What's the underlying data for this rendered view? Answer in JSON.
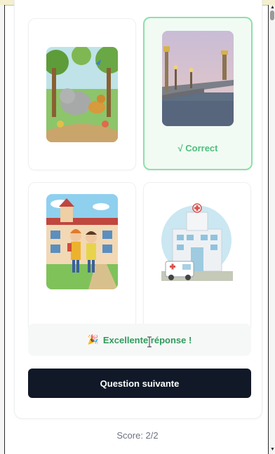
{
  "options": [
    {
      "image_icon": "jungle-animals-image",
      "selected": false
    },
    {
      "image_icon": "paris-bridge-image",
      "selected": true,
      "status_label": "√ Correct"
    },
    {
      "image_icon": "school-children-image",
      "selected": false
    },
    {
      "image_icon": "hospital-ambulance-image",
      "selected": false
    }
  ],
  "feedback": {
    "emoji": "🎉",
    "text": "Excellente réponse !"
  },
  "next_button": {
    "label": "Question suivante"
  },
  "score": {
    "text": "Score: 2/2"
  },
  "colors": {
    "correct": "#4cc07a",
    "selected_border": "#8ee0a8",
    "button_bg": "#111827",
    "feedback_text": "#2f9a5c"
  }
}
